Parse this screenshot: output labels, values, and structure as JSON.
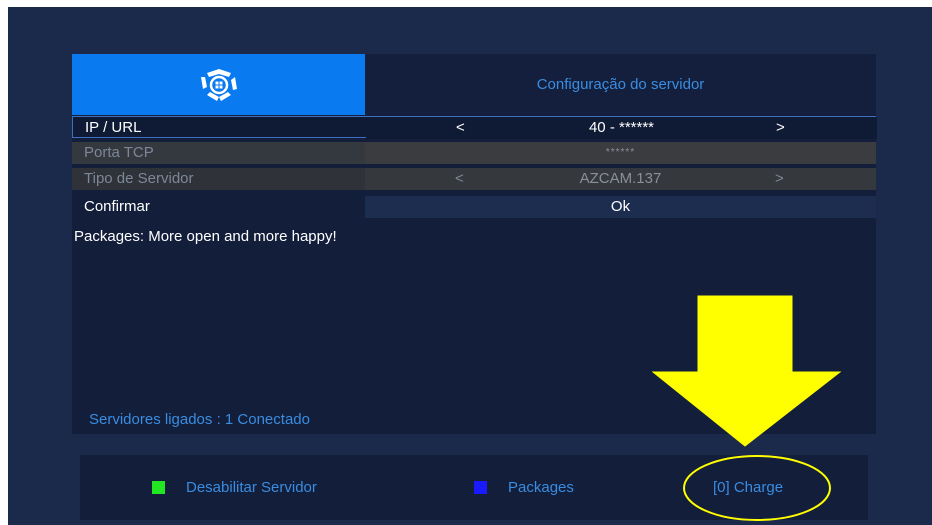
{
  "header": {
    "title": "Configuração do servidor",
    "logo_icon": "brand-logo-icon"
  },
  "settings": {
    "ip": {
      "label": "IP / URL",
      "value": "40 - ******",
      "left_arrow": "<",
      "right_arrow": ">"
    },
    "porta": {
      "label": "Porta TCP",
      "value": "******"
    },
    "tipo": {
      "label": "Tipo de Servidor",
      "value": "AZCAM.137",
      "left_arrow": "<",
      "right_arrow": ">"
    },
    "confirmar": {
      "label": "Confirmar",
      "value": "Ok"
    }
  },
  "message": "Packages: More open and more happy!",
  "status": "Servidores ligados : 1   Conectado",
  "footer": {
    "disable": {
      "label": "Desabilitar Servidor",
      "color": "#22e622"
    },
    "packages": {
      "label": "Packages",
      "color": "#1a1aff"
    },
    "charge": {
      "label": "[0]  Charge"
    }
  },
  "annotation": {
    "arrow_color": "#ffff00",
    "highlight_color": "#ffff00"
  }
}
